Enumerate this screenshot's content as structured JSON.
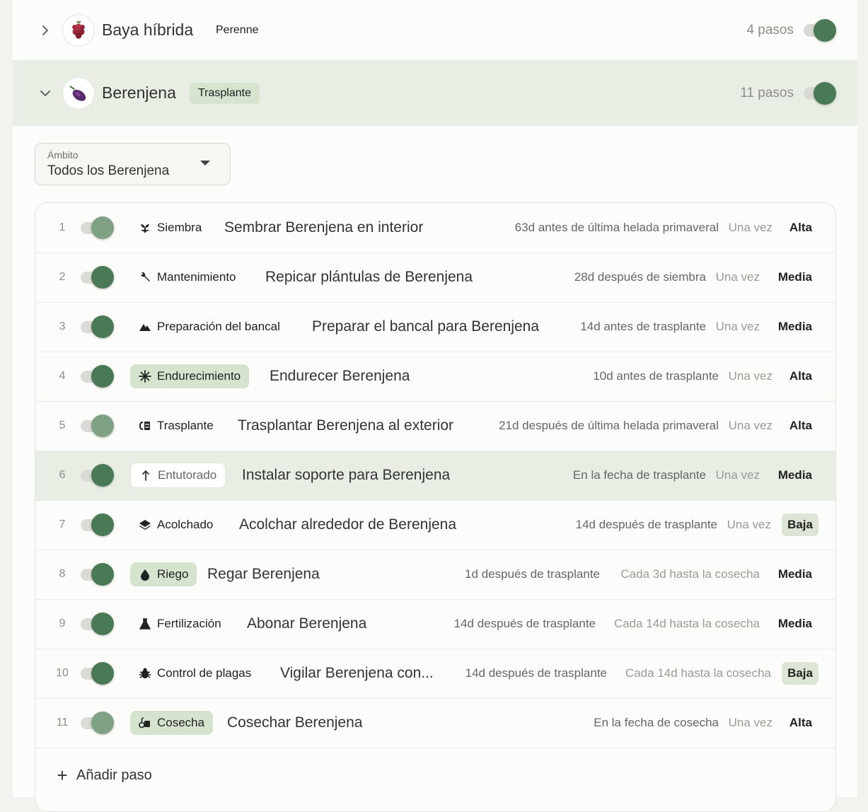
{
  "crops": [
    {
      "name": "Baya híbrida",
      "badge": "Perenne",
      "steps": "4 pasos",
      "expanded": false,
      "enabled": true,
      "icon": "berry-icon"
    },
    {
      "name": "Berenjena",
      "badge": "Trasplante",
      "steps": "11 pasos",
      "expanded": true,
      "enabled": true,
      "icon": "eggplant-icon"
    }
  ],
  "scope": {
    "label": "Ámbito",
    "value": "Todos los Berenjena"
  },
  "steps": [
    {
      "num": "1",
      "enabled_shade": "light",
      "category": "Siembra",
      "category_icon": "seedling-icon",
      "title": "Sembrar Berenjena en interior",
      "timing": "63d antes de última helada primaveral",
      "frequency": "Una vez",
      "priority": "Alta"
    },
    {
      "num": "2",
      "enabled_shade": "dark",
      "category": "Mantenimiento",
      "category_icon": "wrench-icon",
      "title": "Repicar plántulas de Berenjena",
      "timing": "28d después de siembra",
      "frequency": "Una vez",
      "priority": "Media"
    },
    {
      "num": "3",
      "enabled_shade": "dark",
      "category": "Preparación del bancal",
      "category_icon": "mountain-icon",
      "title": "Preparar el bancal para Berenjena",
      "timing": "14d antes de trasplante",
      "frequency": "Una vez",
      "priority": "Media"
    },
    {
      "num": "4",
      "enabled_shade": "dark",
      "category": "Endurecimiento",
      "category_icon": "snowflake-icon",
      "title": "Endurecer Berenjena",
      "timing": "10d antes de trasplante",
      "frequency": "Una vez",
      "priority": "Alta"
    },
    {
      "num": "5",
      "enabled_shade": "light",
      "category": "Trasplante",
      "category_icon": "transplant-icon",
      "title": "Trasplantar Berenjena al exterior",
      "timing": "21d después de última helada primaveral",
      "frequency": "Una vez",
      "priority": "Alta"
    },
    {
      "num": "6",
      "enabled_shade": "dark",
      "category": "Entutorado",
      "category_icon": "arrow-up-icon",
      "title": "Instalar soporte para Berenjena",
      "timing": "En la fecha de trasplante",
      "frequency": "Una vez",
      "priority": "Media"
    },
    {
      "num": "7",
      "enabled_shade": "dark",
      "category": "Acolchado",
      "category_icon": "layers-icon",
      "title": "Acolchar alrededor de Berenjena",
      "timing": "14d después de trasplante",
      "frequency": "Una vez",
      "priority": "Baja"
    },
    {
      "num": "8",
      "enabled_shade": "dark",
      "category": "Riego",
      "category_icon": "drop-icon",
      "title": "Regar Berenjena",
      "timing": "1d después de trasplante",
      "frequency": "Cada 3d hasta la cosecha",
      "priority": "Media"
    },
    {
      "num": "9",
      "enabled_shade": "dark",
      "category": "Fertilización",
      "category_icon": "flask-icon",
      "title": "Abonar Berenjena",
      "timing": "14d después de trasplante",
      "frequency": "Cada 14d hasta la cosecha",
      "priority": "Media"
    },
    {
      "num": "10",
      "enabled_shade": "dark",
      "category": "Control de plagas",
      "category_icon": "bug-icon",
      "title": "Vigilar Berenjena con...",
      "timing": "14d después de trasplante",
      "frequency": "Cada 14d hasta la cosecha",
      "priority": "Baja"
    },
    {
      "num": "11",
      "enabled_shade": "light",
      "category": "Cosecha",
      "category_icon": "harvest-icon",
      "title": "Cosechar Berenjena",
      "timing": "En la fecha de cosecha",
      "frequency": "Una vez",
      "priority": "Alta"
    }
  ],
  "add_step_label": "Añadir paso",
  "colors": {
    "accent_green": "#4a7a55",
    "light_green": "#7fa285",
    "highlight_row": "#e9eee5",
    "badge_tint": "#d5e3cf"
  }
}
